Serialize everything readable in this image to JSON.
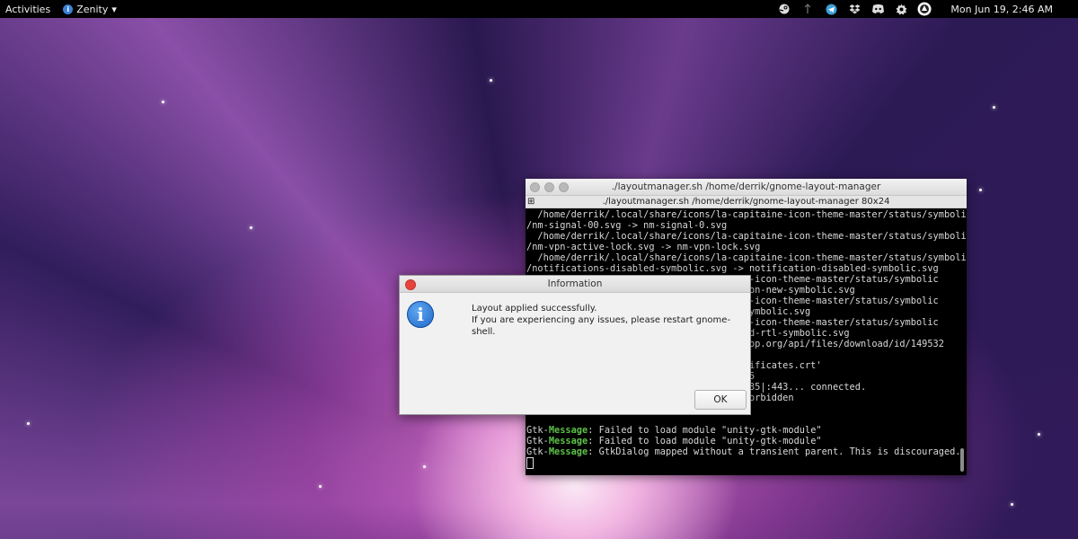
{
  "topbar": {
    "activities": "Activities",
    "app_name": "Zenity",
    "app_menu_arrow": "▾",
    "clock": "Mon Jun 19,  2:46 AM",
    "tray_icons": [
      "steam-icon",
      "network-icon",
      "telegram-icon",
      "dropbox-icon",
      "discord-icon",
      "settings-puzzle-icon",
      "user-avatar-icon"
    ]
  },
  "terminal": {
    "title": "./layoutmanager.sh  /home/derrik/gnome-layout-manager",
    "tab_title": "./layoutmanager.sh  /home/derrik/gnome-layout-manager 80x24",
    "lines": [
      "  /home/derrik/.local/share/icons/la-capitaine-icon-theme-master/status/symbolic",
      "/nm-signal-00.svg -> nm-signal-0.svg",
      "  /home/derrik/.local/share/icons/la-capitaine-icon-theme-master/status/symbolic",
      "/nm-vpn-active-lock.svg -> nm-vpn-lock.svg",
      "  /home/derrik/.local/share/icons/la-capitaine-icon-theme-master/status/symbolic",
      "/notifications-disabled-symbolic.svg -> notification-disabled-symbolic.svg",
      "                                    aine-icon-theme-master/status/symbolic",
      "                                    cation-new-symbolic.svg",
      "                                    aine-icon-theme-master/status/symbolic",
      "                                    on-symbolic.svg",
      "                                    aine-icon-theme-master/status/symbolic",
      "                                    apped-rtl-symbolic.svg",
      "                                    esktop.org/api/files/download/id/149532",
      "",
      "                                    certificates.crt'",
      "                                    4.235",
      "                                    04.235|:443... connected.",
      "                                    03 Forbidden",
      "",
      ""
    ],
    "messages": [
      {
        "prefix": "Gtk-",
        "tag": "Message",
        "text": ": Failed to load module \"unity-gtk-module\""
      },
      {
        "prefix": "Gtk-",
        "tag": "Message",
        "text": ": Failed to load module \"unity-gtk-module\""
      },
      {
        "prefix": "Gtk-",
        "tag": "Message",
        "text": ": GtkDialog mapped without a transient parent. This is discouraged."
      }
    ]
  },
  "dialog": {
    "title": "Information",
    "line1": "Layout applied successfully.",
    "line2": "If you are experiencing any issues, please restart gnome-shell.",
    "ok_label": "OK",
    "icon_glyph": "i"
  }
}
